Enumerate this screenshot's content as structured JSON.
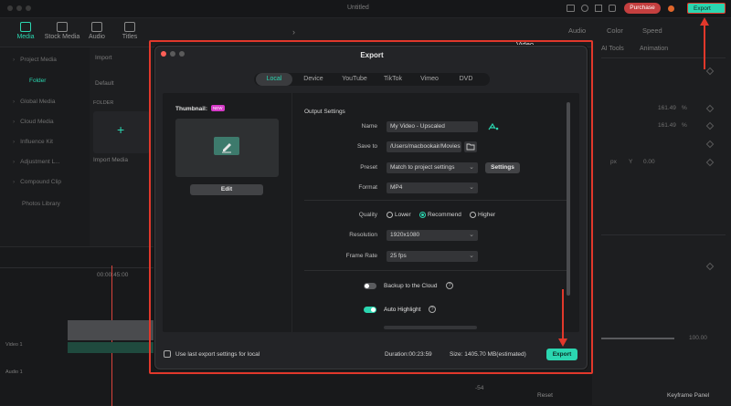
{
  "window": {
    "title": "Untitled"
  },
  "top_buttons": {
    "purchase": "Purchase",
    "export": "Export"
  },
  "toolbar": {
    "items": [
      "Media",
      "Stock Media",
      "Audio",
      "Titles"
    ],
    "right_tabs": [
      "Video",
      "Audio",
      "Color",
      "Speed"
    ],
    "right_subtabs": [
      "AI Tools",
      "Animation"
    ]
  },
  "left_panel": {
    "items": [
      "Project Media",
      "Global Media",
      "Cloud Media",
      "Influence Kit",
      "Adjustment L...",
      "Compound Clip",
      "Photos Library"
    ],
    "folder_label": "Folder",
    "import_label": "Import",
    "default_label": "Default",
    "folder_header": "FOLDER",
    "import_media": "Import Media"
  },
  "timeline": {
    "timecode": "00:00:45:00",
    "track_video": "Video 1",
    "track_audio": "Audio 1"
  },
  "right_panel": {
    "val1": "161.49",
    "val2": "161.49",
    "pct": "%",
    "x_label": "px",
    "y_label": "Y",
    "y_val": "0.00",
    "val3": "100.00",
    "reset": "Reset",
    "keyframe": "Keyframe Panel",
    "minus54": "-54"
  },
  "dialog": {
    "title": "Export",
    "tabs": [
      "Local",
      "Device",
      "YouTube",
      "TikTok",
      "Vimeo",
      "DVD"
    ],
    "active_tab": "Local",
    "thumbnail_label": "Thumbnail:",
    "thumbnail_badge": "NEW",
    "edit_button": "Edit",
    "output_settings": "Output Settings",
    "name_label": "Name",
    "name_value": "My Video - Upscaled",
    "save_to_label": "Save to",
    "save_to_value": "/Users/macbookair/Movies",
    "preset_label": "Preset",
    "preset_value": "Match to project settings",
    "settings_button": "Settings",
    "format_label": "Format",
    "format_value": "MP4",
    "quality_label": "Quality",
    "quality_options": [
      "Lower",
      "Recommend",
      "Higher"
    ],
    "quality_selected": "Recommend",
    "resolution_label": "Resolution",
    "resolution_value": "1920x1080",
    "frame_rate_label": "Frame Rate",
    "frame_rate_value": "25 fps",
    "backup_label": "Backup to the Cloud",
    "backup_on": false,
    "auto_highlight_label": "Auto Highlight",
    "auto_highlight_on": true,
    "last_settings_label": "Use last export settings for local",
    "duration": "Duration:00:23:59",
    "size": "Size: 1405.70 MB(estimated)",
    "export_button": "Export"
  },
  "colors": {
    "accent": "#2bd6b0",
    "annotation_red": "#e1382b",
    "purchase": "#c43f3f"
  }
}
